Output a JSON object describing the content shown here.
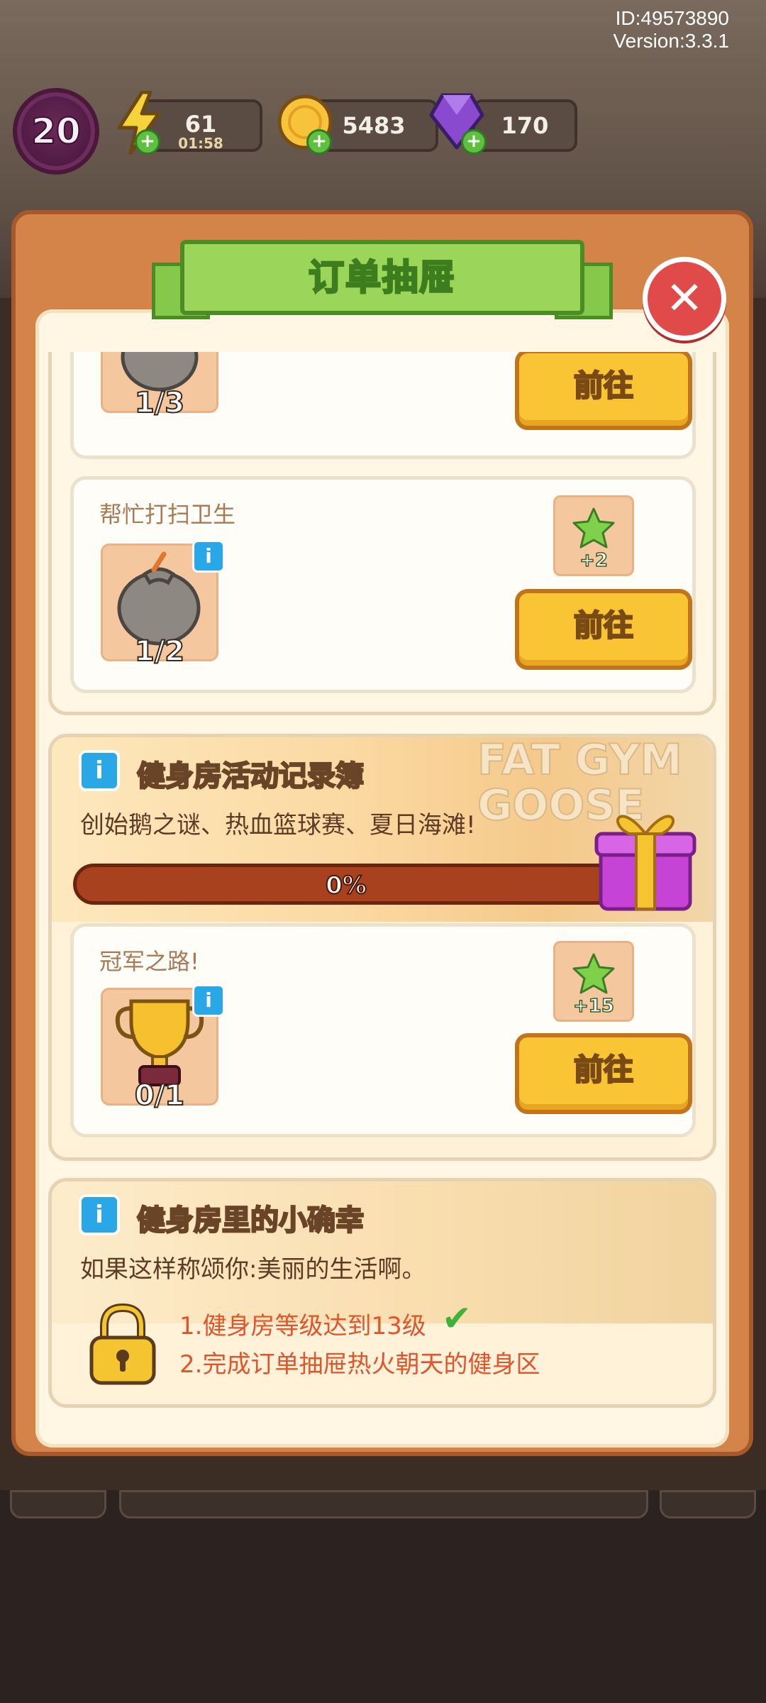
{
  "header": {
    "id_text": "ID:49573890",
    "version_text": "Version:3.3.1",
    "level": "20",
    "energy": {
      "value": "61",
      "timer": "01:58",
      "icon": "lightning-icon"
    },
    "coins": {
      "value": "5483",
      "icon": "coin-icon"
    },
    "gems": {
      "value": "170",
      "icon": "gem-icon"
    }
  },
  "dialog": {
    "title": "订单抽屉",
    "close_icon": "close-icon"
  },
  "tasks_top": [
    {
      "name": "",
      "item_icon": "trash-bag-icon",
      "count": "1/3",
      "button": "前往"
    },
    {
      "name": "帮忙打扫卫生",
      "item_icon": "trash-bag-icon",
      "count": "1/2",
      "reward": "+2",
      "button": "前往"
    }
  ],
  "gym_record": {
    "title": "健身房活动记录簿",
    "description": "创始鹅之谜、热血篮球赛、夏日海滩!",
    "progress_text": "0%",
    "progress_value": 0,
    "banner_text": "FAT GYM GOOSE",
    "gift_icon": "gift-box-icon",
    "task": {
      "name": "冠军之路!",
      "item_icon": "trophy-icon",
      "count": "0/1",
      "reward": "+15",
      "button": "前往"
    }
  },
  "gym_joy": {
    "title": "健身房里的小确幸",
    "description": "如果这样称颂你:美丽的生活啊。",
    "lock_icon": "padlock-icon",
    "requirements": [
      {
        "text": "1.健身房等级达到13级",
        "done": true
      },
      {
        "text": "2.完成订单抽屉热火朝天的健身区",
        "done": false
      }
    ]
  },
  "colors": {
    "panel": "#d48448",
    "ribbon": "#9bd65a",
    "button": "#f9c535",
    "progress_track": "#a8421e",
    "requirement_text": "#e2552b"
  }
}
